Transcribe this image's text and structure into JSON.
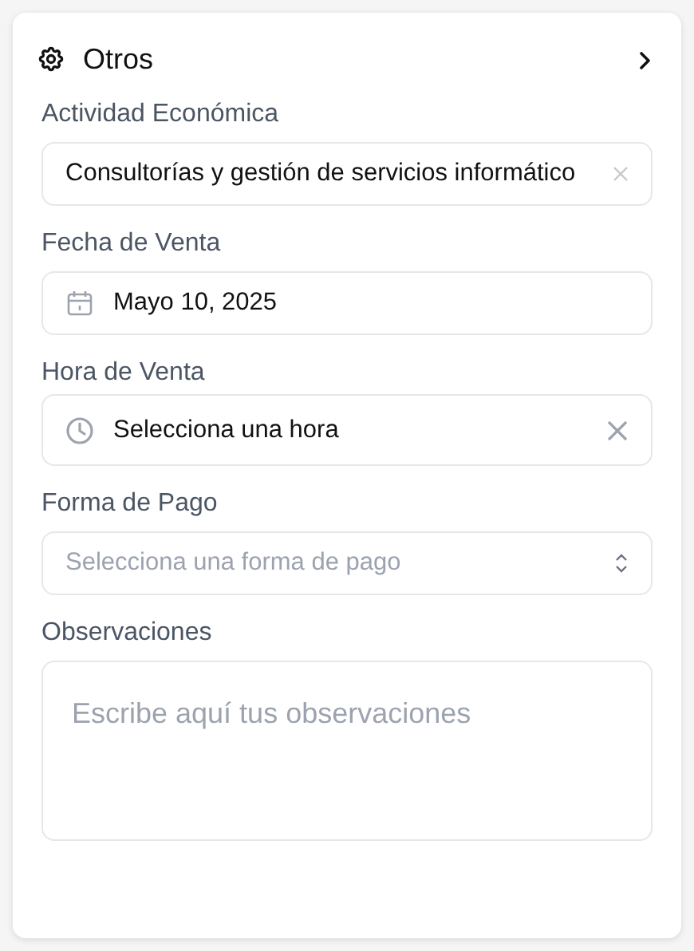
{
  "section": {
    "title": "Otros",
    "expanded": false
  },
  "fields": [
    {
      "kind": "combobox",
      "label": "Actividad Económica",
      "value": "Consultorías y gestión de servicios informático",
      "clearable": true
    },
    {
      "kind": "date",
      "label": "Fecha de Venta",
      "value": "Mayo 10, 2025"
    },
    {
      "kind": "time",
      "label": "Hora de Venta",
      "value": "Selecciona una hora",
      "clearable": true
    },
    {
      "kind": "select",
      "label": "Forma de Pago",
      "placeholder": "Selecciona una forma de pago"
    },
    {
      "kind": "textarea",
      "label": "Observaciones",
      "placeholder": "Escribe aquí tus observaciones"
    }
  ]
}
